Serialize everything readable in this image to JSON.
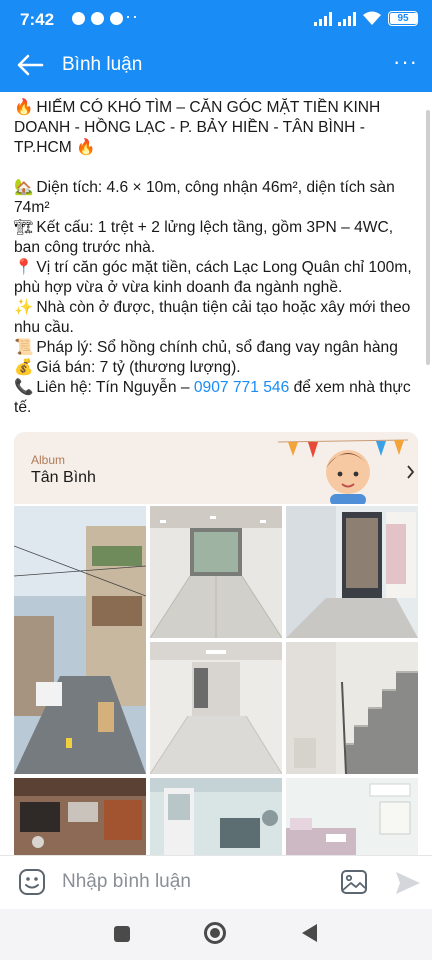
{
  "status": {
    "time": "7:42",
    "more": "···",
    "battery": "95",
    "battery_level": 0.95
  },
  "header": {
    "title": "Bình luận",
    "menu": "···"
  },
  "post": {
    "headline_emoji_a": "🔥",
    "headline": "HIẾM CÓ KHÓ TÌM – CĂN GÓC MẶT TIỀN KINH DOANH - HỒNG LẠC - P. BẢY HIỀN - TÂN BÌNH - TP.HCM",
    "headline_emoji_b": "🔥",
    "lines": [
      {
        "emoji": "🏡",
        "text": "Diện tích: 4.6 × 10m, công nhận 46m², diện tích sàn 74m²"
      },
      {
        "emoji": "🏗",
        "text": "Kết cấu: 1 trệt + 2 lửng lệch tầng, gồm 3PN – 4WC, ban công trước nhà."
      },
      {
        "emoji": "📍",
        "text": "Vị trí căn góc mặt tiền, cách Lạc Long Quân chỉ 100m, phù hợp vừa ở vừa kinh doanh đa ngành nghề."
      },
      {
        "emoji": "✨",
        "text": "Nhà còn ở được, thuận tiện cải tạo hoặc xây mới theo nhu cầu."
      },
      {
        "emoji": "📜",
        "text": "Pháp lý: Sổ hồng chính chủ, sổ đang vay ngân hàng"
      },
      {
        "emoji": "💰",
        "text": "Giá bán: 7 tỷ (thương lượng)."
      }
    ],
    "contact_emoji": "📞",
    "contact_prefix": "Liên hệ: Tín Nguyễn –",
    "contact_phone": "0907 771 546",
    "contact_suffix": "để xem nhà thực tế."
  },
  "album": {
    "label": "Album",
    "name": "Tân Bình"
  },
  "photos": [
    {
      "name": "photo-street-exterior"
    },
    {
      "name": "photo-ground-floor-front"
    },
    {
      "name": "photo-room-wardrobe"
    },
    {
      "name": "photo-ground-floor-rear"
    },
    {
      "name": "photo-staircase"
    },
    {
      "name": "photo-kitchen"
    },
    {
      "name": "photo-room-cabinet"
    },
    {
      "name": "photo-bedroom"
    }
  ],
  "composer": {
    "placeholder": "Nhập bình luận"
  },
  "colors": {
    "brand": "#1a8cf5",
    "link": "#1a8cf5",
    "album_bg": "#f6efe9"
  }
}
